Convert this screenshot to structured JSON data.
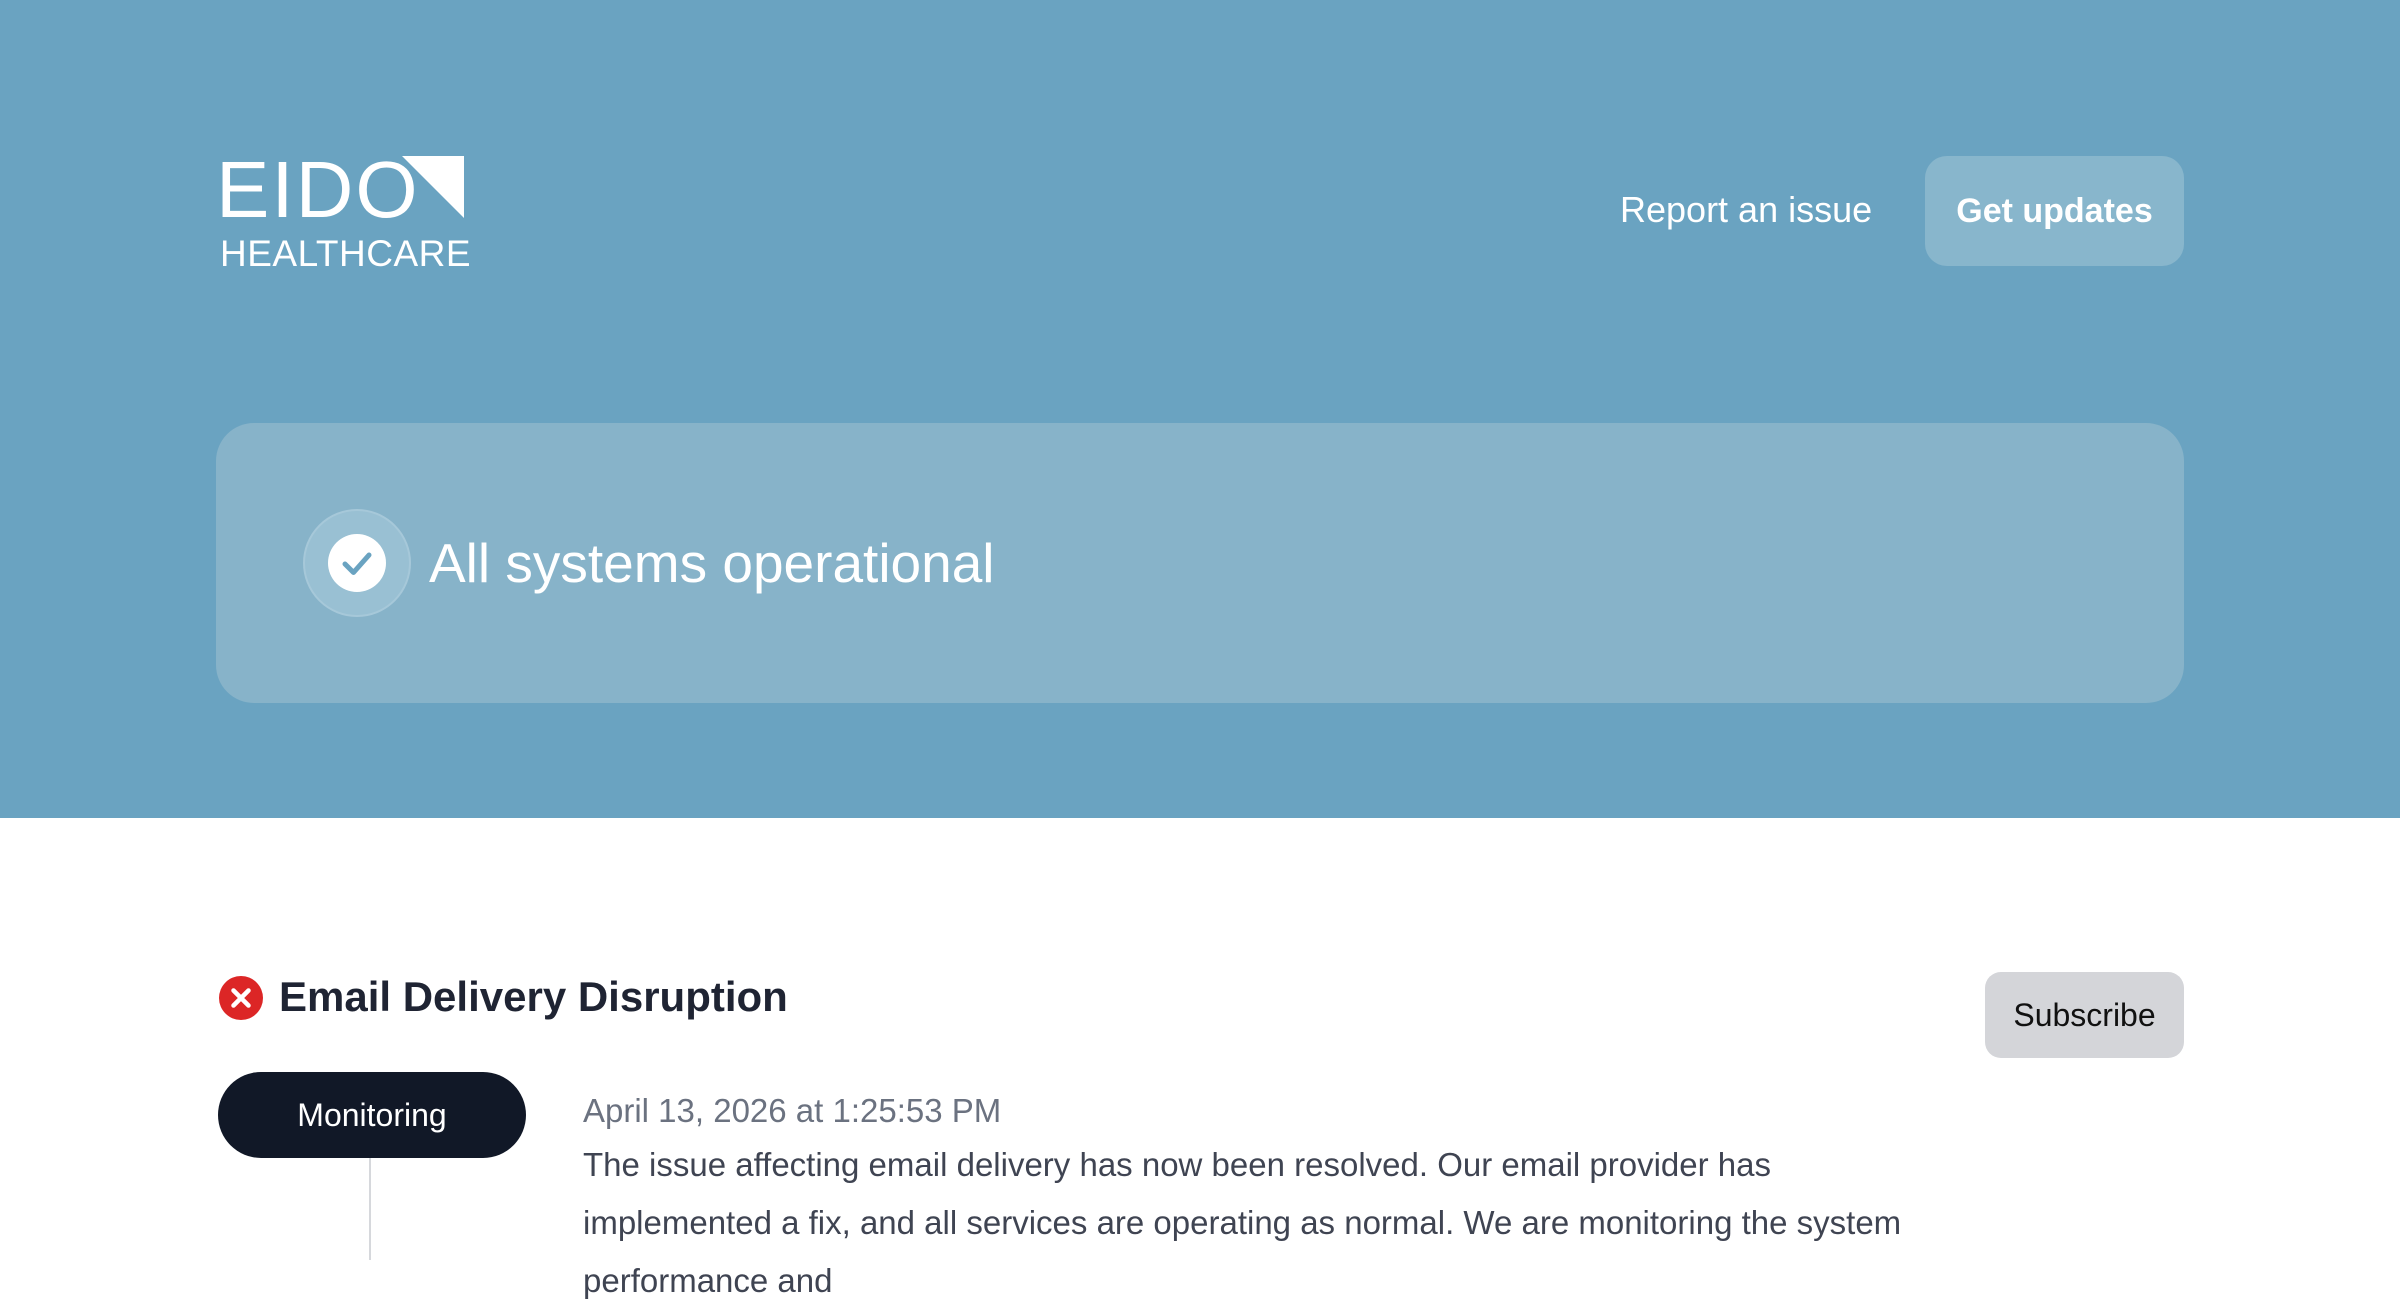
{
  "brand": {
    "logo_word": "EIDO",
    "logo_sub": "HEALTHCARE"
  },
  "header": {
    "report_label": "Report an issue",
    "updates_label": "Get updates"
  },
  "status": {
    "text": "All systems operational",
    "icon": "check-circle-icon"
  },
  "incident": {
    "title": "Email Delivery Disruption",
    "icon": "error-x-icon",
    "subscribe_label": "Subscribe",
    "update": {
      "stage": "Monitoring",
      "timestamp": "April 13, 2026 at 1:25:53 PM",
      "body": "The issue affecting email delivery has now been resolved. Our email provider has implemented a fix, and all services are operating as normal. We are monitoring the system performance and"
    }
  },
  "colors": {
    "hero_bg": "#6aa3c1",
    "card_bg": "#87b3c9",
    "error": "#dc2626",
    "pill_bg": "#111827"
  }
}
